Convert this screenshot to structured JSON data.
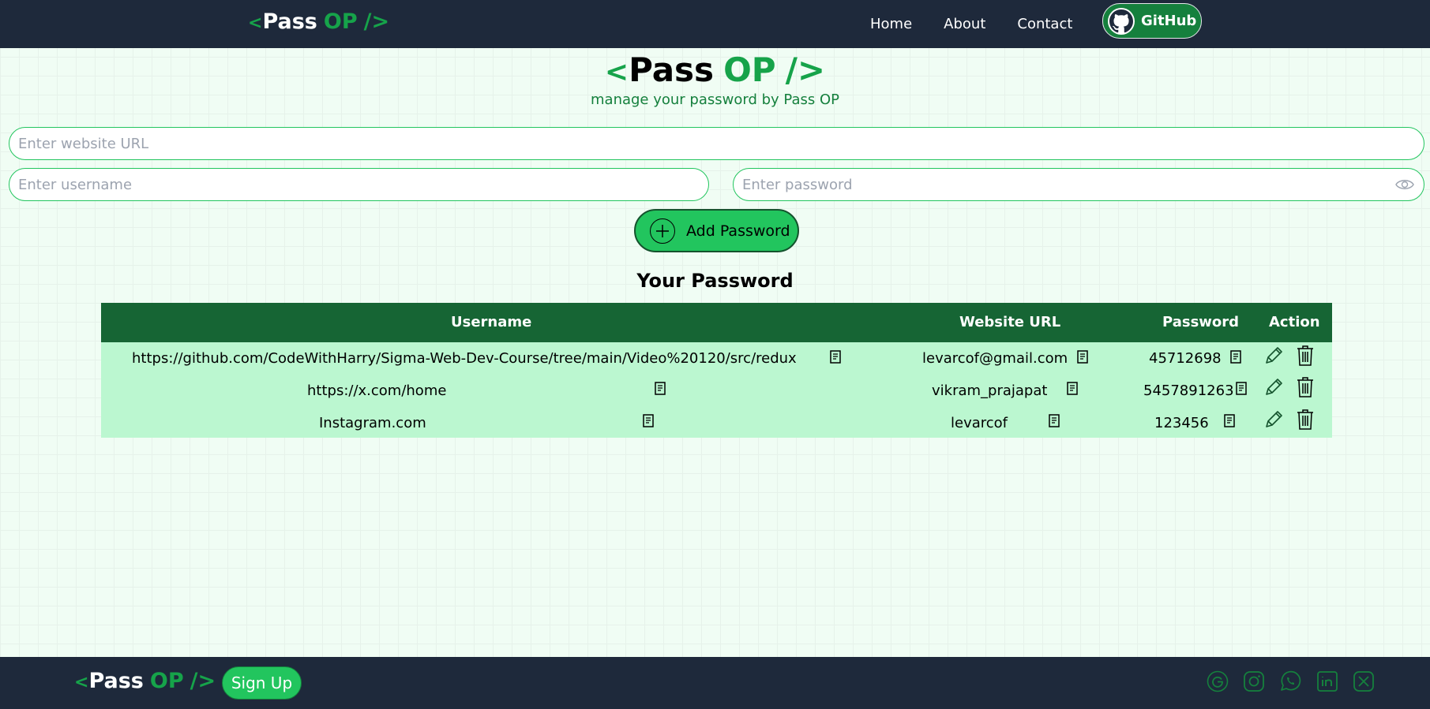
{
  "nav": {
    "logo": {
      "open": "<",
      "pass": "Pass",
      "op": "OP",
      "close": "/>"
    },
    "links": [
      "Home",
      "About",
      "Contact"
    ],
    "github_label": "GitHub"
  },
  "hero": {
    "logo": {
      "open": "<",
      "pass": "Pass",
      "op": "OP",
      "close": "/>"
    },
    "subtitle": "manage your password by Pass OP"
  },
  "form": {
    "url_placeholder": "Enter website URL",
    "username_placeholder": "Enter username",
    "password_placeholder": "Enter password",
    "add_label": "Add Password"
  },
  "table": {
    "title": "Your Password",
    "headers": [
      "Username",
      "Website URL",
      "Password",
      "Action"
    ],
    "rows": [
      {
        "site": "https://github.com/CodeWithHarry/Sigma-Web-Dev-Course/tree/main/Video%20120/src/redux",
        "username": "levarcof@gmail.com",
        "password": "45712698"
      },
      {
        "site": "https://x.com/home",
        "username": "vikram_prajapat",
        "password": "5457891263"
      },
      {
        "site": "Instagram.com",
        "username": "levarcof",
        "password": "123456"
      }
    ]
  },
  "footer": {
    "logo": {
      "open": "<",
      "pass": "Pass",
      "op": "OP",
      "close": "/>"
    },
    "signup_label": "Sign Up",
    "social_icons": [
      "google-icon",
      "instagram-icon",
      "whatsapp-icon",
      "linkedin-icon",
      "x-icon"
    ]
  },
  "colors": {
    "nav_bg": "#1e293b",
    "accent": "#16a34a",
    "table_head": "#166534",
    "table_body": "#bbf7d0",
    "button": "#22c55e"
  }
}
